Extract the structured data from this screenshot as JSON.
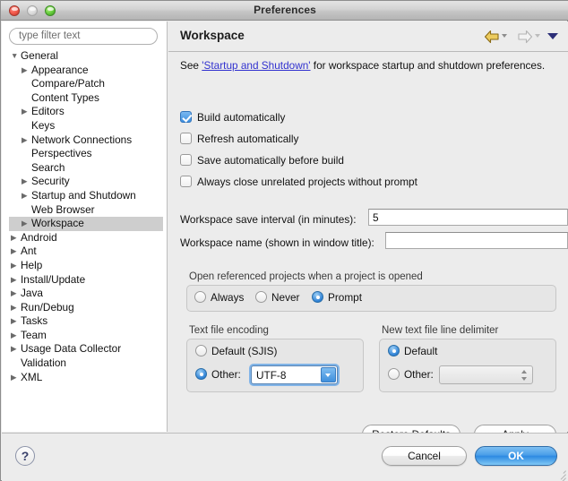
{
  "window": {
    "title": "Preferences",
    "controls": {
      "close": "close",
      "minimize": "minimize",
      "zoom": "zoom"
    }
  },
  "sidebar": {
    "filter": {
      "placeholder": "type filter text",
      "value": ""
    },
    "tree": [
      {
        "label": "General",
        "indent": 0,
        "twisty": "open",
        "selected": false
      },
      {
        "label": "Appearance",
        "indent": 1,
        "twisty": "closed",
        "selected": false
      },
      {
        "label": "Compare/Patch",
        "indent": 1,
        "twisty": "none",
        "selected": false
      },
      {
        "label": "Content Types",
        "indent": 1,
        "twisty": "none",
        "selected": false
      },
      {
        "label": "Editors",
        "indent": 1,
        "twisty": "closed",
        "selected": false
      },
      {
        "label": "Keys",
        "indent": 1,
        "twisty": "none",
        "selected": false
      },
      {
        "label": "Network Connections",
        "indent": 1,
        "twisty": "closed",
        "selected": false
      },
      {
        "label": "Perspectives",
        "indent": 1,
        "twisty": "none",
        "selected": false
      },
      {
        "label": "Search",
        "indent": 1,
        "twisty": "none",
        "selected": false
      },
      {
        "label": "Security",
        "indent": 1,
        "twisty": "closed",
        "selected": false
      },
      {
        "label": "Startup and Shutdown",
        "indent": 1,
        "twisty": "closed",
        "selected": false
      },
      {
        "label": "Web Browser",
        "indent": 1,
        "twisty": "none",
        "selected": false
      },
      {
        "label": "Workspace",
        "indent": 1,
        "twisty": "closed",
        "selected": true
      },
      {
        "label": "Android",
        "indent": 0,
        "twisty": "closed",
        "selected": false
      },
      {
        "label": "Ant",
        "indent": 0,
        "twisty": "closed",
        "selected": false
      },
      {
        "label": "Help",
        "indent": 0,
        "twisty": "closed",
        "selected": false
      },
      {
        "label": "Install/Update",
        "indent": 0,
        "twisty": "closed",
        "selected": false
      },
      {
        "label": "Java",
        "indent": 0,
        "twisty": "closed",
        "selected": false
      },
      {
        "label": "Run/Debug",
        "indent": 0,
        "twisty": "closed",
        "selected": false
      },
      {
        "label": "Tasks",
        "indent": 0,
        "twisty": "closed",
        "selected": false
      },
      {
        "label": "Team",
        "indent": 0,
        "twisty": "closed",
        "selected": false
      },
      {
        "label": "Usage Data Collector",
        "indent": 0,
        "twisty": "closed",
        "selected": false
      },
      {
        "label": "Validation",
        "indent": 0,
        "twisty": "none",
        "selected": false
      },
      {
        "label": "XML",
        "indent": 0,
        "twisty": "closed",
        "selected": false
      }
    ]
  },
  "panel": {
    "title": "Workspace",
    "nav": {
      "back": "back-arrow",
      "back_menu": "back-dropdown",
      "forward": "forward-arrow",
      "forward_menu": "forward-dropdown",
      "menu": "view-menu"
    },
    "description": {
      "prefix": "See ",
      "link": "'Startup and Shutdown'",
      "suffix": " for workspace startup and shutdown preferences."
    },
    "checkboxes": [
      {
        "label": "Build automatically",
        "checked": true
      },
      {
        "label": "Refresh automatically",
        "checked": false
      },
      {
        "label": "Save automatically before build",
        "checked": false
      },
      {
        "label": "Always close unrelated projects without prompt",
        "checked": false
      }
    ],
    "fields": [
      {
        "label": "Workspace save interval (in minutes):",
        "value": "5",
        "placeholder": ""
      },
      {
        "label": "Workspace name (shown in window title):",
        "value": "",
        "placeholder": ""
      }
    ],
    "referenced_projects": {
      "label": "Open referenced projects when a project is opened",
      "options": [
        {
          "label": "Always",
          "selected": false
        },
        {
          "label": "Never",
          "selected": false
        },
        {
          "label": "Prompt",
          "selected": true
        }
      ]
    },
    "text_file_encoding": {
      "label": "Text file encoding",
      "default_option": {
        "label": "Default (SJIS)",
        "selected": false
      },
      "other_option": {
        "label": "Other:",
        "selected": true
      },
      "combo_value": "UTF-8"
    },
    "line_delimiter": {
      "label": "New text file line delimiter",
      "default_option": {
        "label": "Default",
        "selected": true
      },
      "other_option": {
        "label": "Other:",
        "selected": false
      },
      "combo_value": ""
    },
    "buttons": {
      "restore_defaults": "Restore Defaults",
      "apply": "Apply"
    }
  },
  "footer": {
    "help": "?",
    "cancel": "Cancel",
    "ok": "OK"
  },
  "colors": {
    "accent_blue": "#3d8fe0",
    "link": "#3131cf",
    "back_arrow": "#e8c34a",
    "window_bg": "#ececec",
    "selection": "#cecece"
  }
}
